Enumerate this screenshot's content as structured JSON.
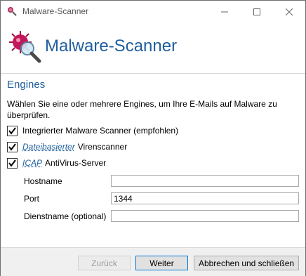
{
  "window": {
    "title": "Malware-Scanner"
  },
  "header": {
    "title": "Malware-Scanner"
  },
  "engines": {
    "section_title": "Engines",
    "description": "Wählen Sie eine oder mehrere Engines, um Ihre E-Mails auf Malware zu überprüfen.",
    "options": [
      {
        "label": "Integrierter Malware Scanner (empfohlen)",
        "checked": true
      },
      {
        "link": "Dateibasierter",
        "label": "Virenscanner",
        "checked": true
      },
      {
        "link": "ICAP",
        "label": "AntiVirus-Server",
        "checked": true
      }
    ],
    "fields": {
      "hostname": {
        "label": "Hostname",
        "value": ""
      },
      "port": {
        "label": "Port",
        "value": "1344"
      },
      "service": {
        "label": "Dienstname (optional)",
        "value": ""
      }
    }
  },
  "footer": {
    "back_label": "Zurück",
    "next_label": "Weiter",
    "cancel_label": "Abbrechen und schließen"
  },
  "colors": {
    "accent": "#1f5f9e"
  }
}
